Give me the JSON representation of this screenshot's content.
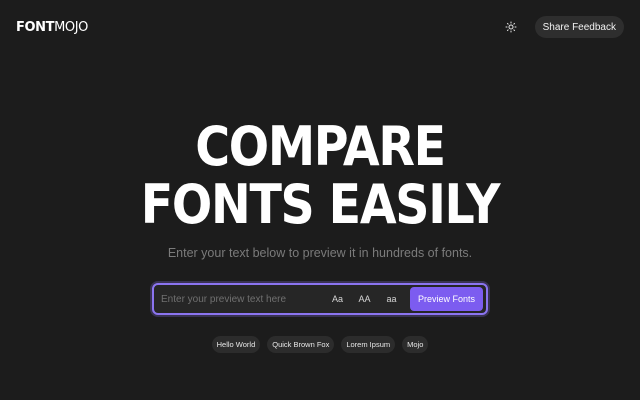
{
  "header": {
    "logo_bold": "FONT",
    "logo_light": "MOJO",
    "theme_icon": "sun-icon",
    "feedback_label": "Share Feedback"
  },
  "hero": {
    "title_line1": "COMPARE",
    "title_line2": "FONTS EASILY",
    "subtitle": "Enter your text below to preview it in hundreds of fonts."
  },
  "preview": {
    "input_value": "",
    "placeholder": "Enter your preview text here",
    "case_options": [
      "Aa",
      "AA",
      "aa"
    ],
    "submit_label": "Preview Fonts"
  },
  "suggestions": [
    "Hello World",
    "Quick Brown Fox",
    "Lorem Ipsum",
    "Mojo"
  ],
  "colors": {
    "background": "#1c1c1c",
    "accent": "#7c5cf0",
    "accent_border": "#8b74f0"
  }
}
